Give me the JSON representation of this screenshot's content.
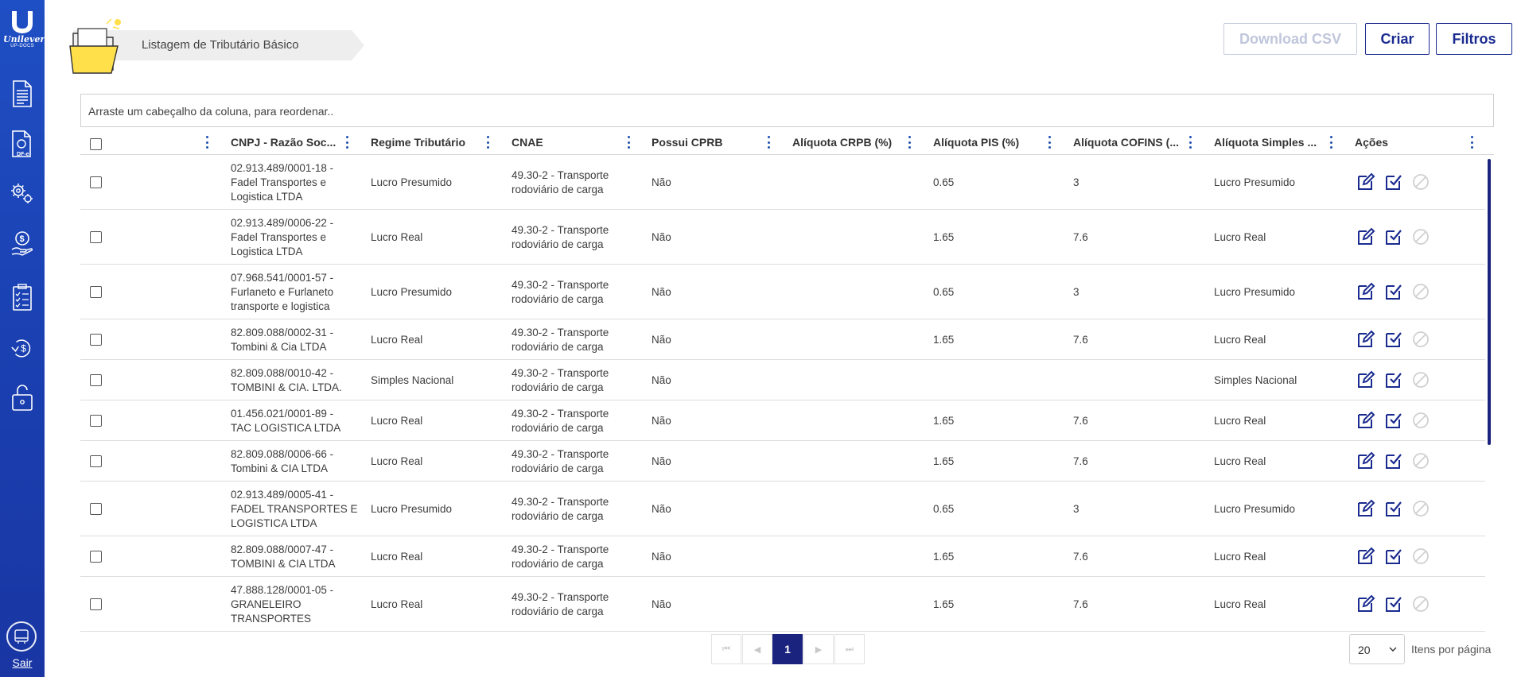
{
  "sidebar": {
    "logo_text": "Unilever",
    "logo_subtext": "UP-DOCS",
    "nav_icons": [
      "document-icon",
      "dfe-document-icon",
      "gears-icon",
      "money-hand-icon",
      "checklist-icon",
      "refresh-money-icon",
      "lock-icon"
    ],
    "dfe_label": "DF-e",
    "exit_icon": "exit-icon",
    "exit_label": "Sair"
  },
  "header": {
    "breadcrumb_title": "Listagem de Tributário Básico"
  },
  "toolbar": {
    "download_label": "Download CSV",
    "create_label": "Criar",
    "filters_label": "Filtros"
  },
  "grouping": {
    "placeholder": "Arraste um cabeçalho da coluna, para reordenar.."
  },
  "columns": [
    "CNPJ - Razão Soc...",
    "Regime Tributário",
    "CNAE",
    "Possui CPRB",
    "Alíquota CRPB (%)",
    "Alíquota PIS (%)",
    "Alíquota COFINS (...",
    "Alíquota Simples ...",
    "Ações"
  ],
  "rows": [
    {
      "cnpj": [
        "02.913.489/0001-18 -",
        "Fadel Transportes e",
        "Logistica LTDA"
      ],
      "regime": "Lucro Presumido",
      "cnae": [
        "49.30-2 - Transporte",
        "rodoviário de carga"
      ],
      "cprb": "Não",
      "crpb": "",
      "pis": "0.65",
      "cofins": "3",
      "simples": "Lucro Presumido"
    },
    {
      "cnpj": [
        "02.913.489/0006-22 -",
        "Fadel Transportes e",
        "Logistica LTDA"
      ],
      "regime": "Lucro Real",
      "cnae": [
        "49.30-2 - Transporte",
        "rodoviário de carga"
      ],
      "cprb": "Não",
      "crpb": "",
      "pis": "1.65",
      "cofins": "7.6",
      "simples": "Lucro Real"
    },
    {
      "cnpj": [
        "07.968.541/0001-57 -",
        "Furlaneto e Furlaneto",
        "transporte e logistica"
      ],
      "regime": "Lucro Presumido",
      "cnae": [
        "49.30-2 - Transporte",
        "rodoviário de carga"
      ],
      "cprb": "Não",
      "crpb": "",
      "pis": "0.65",
      "cofins": "3",
      "simples": "Lucro Presumido"
    },
    {
      "cnpj": [
        "82.809.088/0002-31 -",
        "Tombini & Cia LTDA"
      ],
      "regime": "Lucro Real",
      "cnae": [
        "49.30-2 - Transporte",
        "rodoviário de carga"
      ],
      "cprb": "Não",
      "crpb": "",
      "pis": "1.65",
      "cofins": "7.6",
      "simples": "Lucro Real"
    },
    {
      "cnpj": [
        "82.809.088/0010-42 -",
        "TOMBINI & CIA. LTDA."
      ],
      "regime": "Simples Nacional",
      "cnae": [
        "49.30-2 - Transporte",
        "rodoviário de carga"
      ],
      "cprb": "Não",
      "crpb": "",
      "pis": "",
      "cofins": "",
      "simples": "Simples Nacional"
    },
    {
      "cnpj": [
        "01.456.021/0001-89 -",
        "TAC LOGISTICA LTDA"
      ],
      "regime": "Lucro Real",
      "cnae": [
        "49.30-2 - Transporte",
        "rodoviário de carga"
      ],
      "cprb": "Não",
      "crpb": "",
      "pis": "1.65",
      "cofins": "7.6",
      "simples": "Lucro Real"
    },
    {
      "cnpj": [
        "82.809.088/0006-66 -",
        "Tombini & CIA LTDA"
      ],
      "regime": "Lucro Real",
      "cnae": [
        "49.30-2 - Transporte",
        "rodoviário de carga"
      ],
      "cprb": "Não",
      "crpb": "",
      "pis": "1.65",
      "cofins": "7.6",
      "simples": "Lucro Real"
    },
    {
      "cnpj": [
        "02.913.489/0005-41 -",
        "FADEL TRANSPORTES E",
        "LOGISTICA LTDA"
      ],
      "regime": "Lucro Presumido",
      "cnae": [
        "49.30-2 - Transporte",
        "rodoviário de carga"
      ],
      "cprb": "Não",
      "crpb": "",
      "pis": "0.65",
      "cofins": "3",
      "simples": "Lucro Presumido"
    },
    {
      "cnpj": [
        "82.809.088/0007-47 -",
        "TOMBINI & CIA LTDA"
      ],
      "regime": "Lucro Real",
      "cnae": [
        "49.30-2 - Transporte",
        "rodoviário de carga"
      ],
      "cprb": "Não",
      "crpb": "",
      "pis": "1.65",
      "cofins": "7.6",
      "simples": "Lucro Real"
    },
    {
      "cnpj": [
        "47.888.128/0001-05 -",
        "GRANELEIRO",
        "TRANSPORTES"
      ],
      "regime": "Lucro Real",
      "cnae": [
        "49.30-2 - Transporte",
        "rodoviário de carga"
      ],
      "cprb": "Não",
      "crpb": "",
      "pis": "1.65",
      "cofins": "7.6",
      "simples": "Lucro Real"
    }
  ],
  "row_actions": [
    "edit-icon",
    "checkbox-checked-icon",
    "disabled-circle-icon"
  ],
  "pagination": {
    "first_icon": "first-page-icon",
    "prev_icon": "previous-page-icon",
    "current_page": "1",
    "next_icon": "next-page-icon",
    "last_icon": "last-page-icon",
    "items_per_page_value": "20",
    "items_per_page_label": "Itens por página"
  },
  "colors": {
    "sidebar": "#1f4fc4",
    "accent": "#1a237e",
    "kebab": "#1e4fb0"
  }
}
